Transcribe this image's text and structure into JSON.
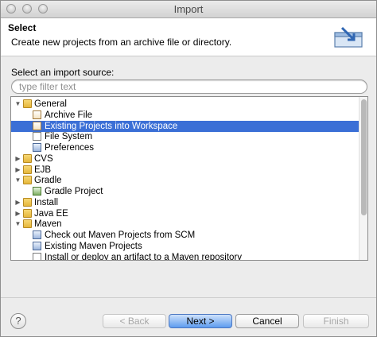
{
  "window": {
    "title": "Import"
  },
  "header": {
    "heading": "Select",
    "description": "Create new projects from an archive file or directory."
  },
  "source": {
    "label": "Select an import source:",
    "filter_placeholder": "type filter text",
    "filter_value": ""
  },
  "tree": {
    "items": [
      {
        "label": "General",
        "level": 0,
        "expanded": true,
        "icon": "folder-icon"
      },
      {
        "label": "Archive File",
        "level": 1,
        "icon": "archive-file-icon"
      },
      {
        "label": "Existing Projects into Workspace",
        "level": 1,
        "icon": "existing-projects-icon",
        "selected": true
      },
      {
        "label": "File System",
        "level": 1,
        "icon": "file-system-icon"
      },
      {
        "label": "Preferences",
        "level": 1,
        "icon": "preferences-icon"
      },
      {
        "label": "CVS",
        "level": 0,
        "expanded": false,
        "icon": "folder-icon"
      },
      {
        "label": "EJB",
        "level": 0,
        "expanded": false,
        "icon": "folder-icon"
      },
      {
        "label": "Gradle",
        "level": 0,
        "expanded": true,
        "icon": "folder-icon"
      },
      {
        "label": "Gradle Project",
        "level": 1,
        "icon": "gradle-project-icon"
      },
      {
        "label": "Install",
        "level": 0,
        "expanded": false,
        "icon": "folder-icon"
      },
      {
        "label": "Java EE",
        "level": 0,
        "expanded": false,
        "icon": "folder-icon"
      },
      {
        "label": "Maven",
        "level": 0,
        "expanded": true,
        "icon": "folder-icon"
      },
      {
        "label": "Check out Maven Projects from SCM",
        "level": 1,
        "icon": "maven-scm-icon"
      },
      {
        "label": "Existing Maven Projects",
        "level": 1,
        "icon": "maven-projects-icon"
      },
      {
        "label": "Install or deploy an artifact to a Maven repository",
        "level": 1,
        "icon": "maven-artifact-icon"
      }
    ]
  },
  "buttons": {
    "help": "?",
    "back": "< Back",
    "next": "Next >",
    "cancel": "Cancel",
    "finish": "Finish"
  },
  "colors": {
    "selection": "#3b6fd6",
    "primary_button": "#5d9cef"
  }
}
